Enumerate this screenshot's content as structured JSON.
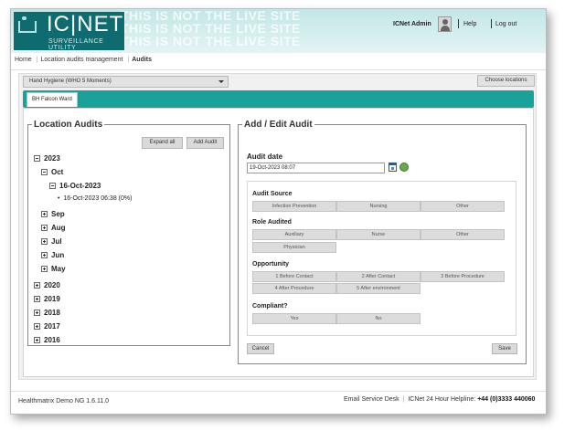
{
  "header": {
    "logo_text": "IC|NET",
    "logo_subtitle": "SURVEILLANCE UTILITY",
    "watermark": "THIS IS NOT THE LIVE SITE",
    "user_label": "ICNet Admin",
    "help_label": "Help",
    "logout_label": "Log out"
  },
  "breadcrumb": {
    "home": "Home",
    "section": "Location audits management",
    "current": "Audits"
  },
  "toolbar": {
    "protocol_value": "Hand Hygiene (WHO 5 Moments)",
    "choose_locations_label": "Choose locations"
  },
  "ward_tab": "BH Falcon Ward",
  "location_audits": {
    "legend": "Location Audits",
    "expand_all_label": "Expand all",
    "add_audit_label": "Add Audit",
    "tree": {
      "year_2023": "2023",
      "month_oct": "Oct",
      "day": "16-Oct-2023",
      "audit_entry": "16-Oct-2023 06:38 (0%)",
      "months_collapsed": [
        "Sep",
        "Aug",
        "Jul",
        "Jun",
        "May"
      ],
      "years_collapsed": [
        "2020",
        "2019",
        "2018",
        "2017",
        "2016"
      ]
    }
  },
  "edit_audit": {
    "legend": "Add / Edit Audit",
    "audit_date_label": "Audit date",
    "audit_date_value": "19-Oct-2023 08:07",
    "audit_source_label": "Audit Source",
    "audit_source_options": [
      "Infection Prevention",
      "Nursing",
      "Other"
    ],
    "role_audited_label": "Role Audited",
    "role_options": [
      "Auxiliary",
      "Nurse",
      "Other",
      "Physician"
    ],
    "opportunity_label": "Opportunity",
    "opportunity_options": [
      "1 Before Contact",
      "2 After Contact",
      "3 Before Procedure",
      "4 After Procedure",
      "5 After environment"
    ],
    "compliant_label": "Compliant?",
    "compliant_options": [
      "Yes",
      "No"
    ],
    "cancel_label": "Cancel",
    "save_label": "Save"
  },
  "footer": {
    "left_text": "Healthmatrix Demo NG 1.6.11.0",
    "service_desk": "Email Service Desk",
    "helpline_label": "ICNet 24 Hour Helpline:",
    "helpline_number": "+44 (0)3333 440060"
  },
  "colors": {
    "brand_teal": "#0e6b70",
    "ward_bar": "#1aa29a"
  }
}
